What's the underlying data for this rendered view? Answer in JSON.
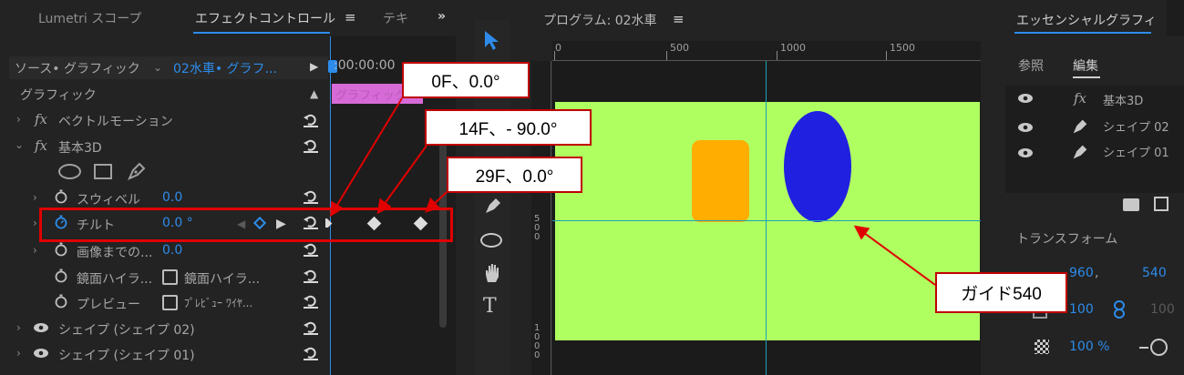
{
  "left_panel": {
    "tabs": [
      "Lumetri スコープ",
      "エフェクトコントロール",
      "テキ"
    ],
    "menu_glyph": "≡",
    "overflow_glyph": "»",
    "source_label": "ソース• グラフィック",
    "sequence_label": "02水車• グラフ...",
    "timecode": ":00:00:00",
    "clip_label": "グラフィック",
    "section_title": "グラフィック",
    "effects": [
      {
        "name": "ベクトルモーション"
      },
      {
        "name": "基本3D"
      }
    ],
    "params": [
      {
        "name": "スウィベル",
        "value": "0.0"
      },
      {
        "name": "チルト",
        "value": "0.0 °"
      },
      {
        "name": "画像までの...",
        "value": "0.0"
      },
      {
        "name": "鏡面ハイラ...",
        "checkbox_label": "鏡面ハイラ..."
      },
      {
        "name": "プレビュー",
        "checkbox_label": "ﾌﾟﾚﾋﾞｭｰ ﾜｲﾔ..."
      }
    ],
    "layers": [
      "シェイプ (シェイプ 02)",
      "シェイプ (シェイプ 01)"
    ]
  },
  "program": {
    "title": "プログラム: 02水車",
    "menu_glyph": "≡",
    "ruler_ticks": [
      "0",
      "500",
      "1000",
      "1500"
    ],
    "ruler_left_ticks": [
      "5\n0\n0",
      "1\n0\n0\n0"
    ]
  },
  "right_panel": {
    "title": "エッセンシャルグラフィ",
    "tabs": [
      "参照",
      "編集"
    ],
    "layers": [
      "基本3D",
      "シェイプ 02",
      "シェイプ 01"
    ],
    "section": "トランスフォーム",
    "position": [
      "960",
      ",",
      "540"
    ],
    "scale": "100",
    "scale2": "100",
    "opacity": "100 %"
  },
  "callouts": {
    "kf0": "0F、0.0°",
    "kf14": "14F、- 90.0°",
    "kf29": "29F、0.0°",
    "guide": "ガイド540"
  },
  "colors": {
    "accent_blue": "#2d8ceb",
    "canvas_green": "#b0ff61",
    "rect_orange": "#ffad00",
    "ellipse_blue": "#2020e0",
    "guide_cyan": "#1aa3b8",
    "callout_red": "#c00000"
  }
}
